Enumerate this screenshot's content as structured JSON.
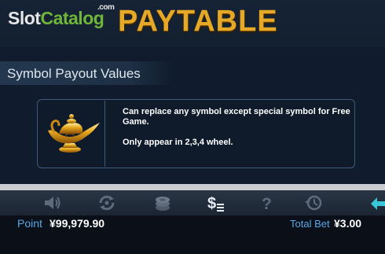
{
  "header": {
    "logo_slot": "Slot",
    "logo_catalog": "Catalog",
    "logo_com": ".com",
    "title": "PAYTABLE"
  },
  "section": {
    "title": "Symbol Payout Values"
  },
  "symbol_card": {
    "icon": "magic-lamp-icon",
    "description": "Can replace any symbol except special symbol for Free Game.",
    "note": "Only appear in 2,3,4 wheel."
  },
  "toolbar": {
    "buttons": [
      "sound-icon",
      "autoplay-icon",
      "bet-chips-icon",
      "paytable-icon",
      "help-icon",
      "history-icon",
      "back-icon"
    ]
  },
  "status": {
    "point_label": "Point",
    "point_value": "¥99,979.90",
    "bet_label": "Total Bet",
    "bet_value": "¥3.00"
  },
  "colors": {
    "title_gold": "#e6a827",
    "label_blue": "#56a9e8",
    "accent_teal": "#38c6d8",
    "logo_green": "#6fb53a"
  }
}
